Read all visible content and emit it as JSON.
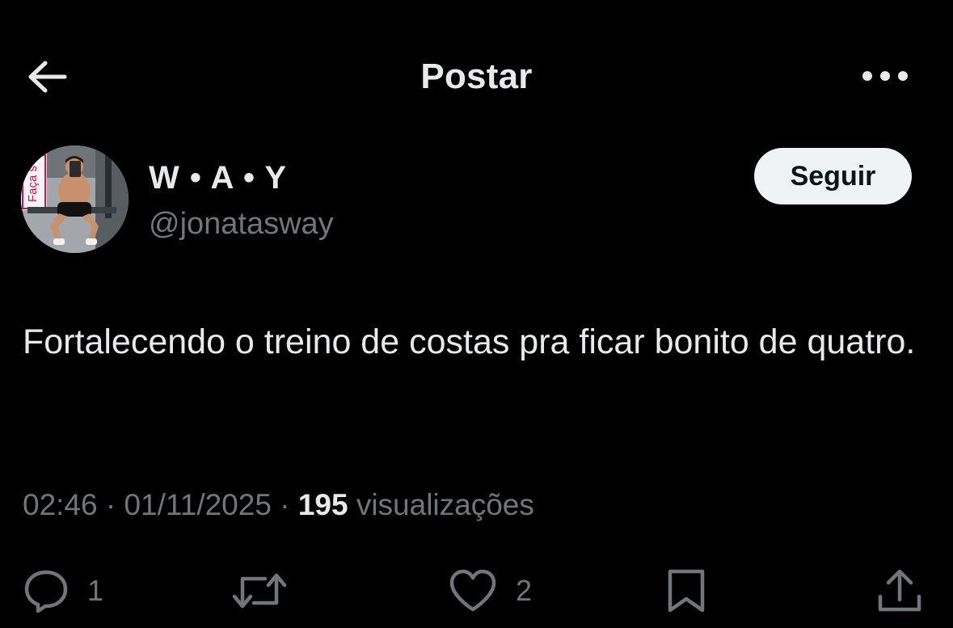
{
  "header": {
    "back_icon": "arrow-left-icon",
    "title": "Postar",
    "more_icon": "more-horizontal-icon"
  },
  "author": {
    "display_name": "W • A • Y",
    "handle": "@jonatasway",
    "follow_label": "Seguir",
    "avatar_sign_text": "Faça s"
  },
  "post": {
    "text": "Fortalecendo o treino de costas pra ficar bonito de quatro."
  },
  "meta": {
    "time": "02:46",
    "separator": " · ",
    "date": "01/11/2025",
    "views_count": "195",
    "views_label": "visualizações"
  },
  "actions": {
    "reply": {
      "icon": "reply-icon",
      "count": "1"
    },
    "repost": {
      "icon": "repost-icon"
    },
    "like": {
      "icon": "heart-icon",
      "count": "2"
    },
    "bookmark": {
      "icon": "bookmark-icon"
    },
    "share": {
      "icon": "share-icon"
    }
  },
  "colors": {
    "background": "#000000",
    "primary_text": "#e7e9ea",
    "secondary_text": "#71767b",
    "follow_button_bg": "#eff3f4",
    "follow_button_text": "#0f1419"
  }
}
